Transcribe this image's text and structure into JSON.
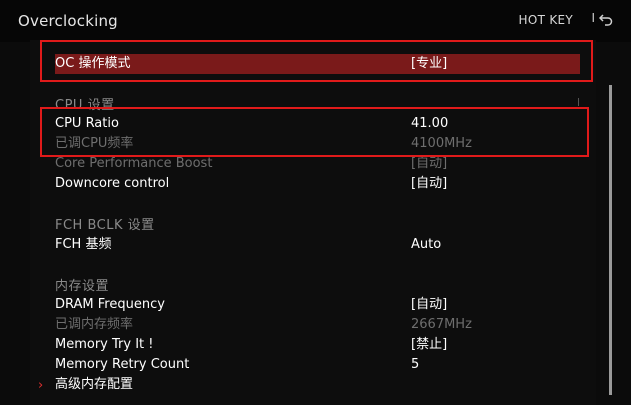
{
  "header": {
    "title": "Overclocking",
    "hotkey": "HOT KEY",
    "separator": "I"
  },
  "sections": {
    "cpu": "CPU  设置",
    "fch": "FCH  BCLK  设置",
    "mem": "内存设置"
  },
  "rows": [
    {
      "label": "OC 操作模式",
      "value": "[专业]"
    },
    {
      "label": "CPU Ratio",
      "value": "41.00"
    },
    {
      "label": "已调CPU频率",
      "value": "4100MHz"
    },
    {
      "label": "Core Performance Boost",
      "value": "[自动]"
    },
    {
      "label": "Downcore control",
      "value": "[自动]"
    },
    {
      "label": "FCH 基频",
      "value": "Auto"
    },
    {
      "label": "DRAM Frequency",
      "value": "[自动]"
    },
    {
      "label": "已调内存频率",
      "value": "2667MHz"
    },
    {
      "label": "Memory Try It !",
      "value": "[禁止]"
    },
    {
      "label": "Memory Retry Count",
      "value": "5"
    },
    {
      "label": "高级内存配置",
      "value": ""
    }
  ],
  "submenu_arrow": "›",
  "colors": {
    "highlight_border": "#e01a1a",
    "selected_row": "#7a1a1a",
    "dim_text": "#6e6e6e"
  }
}
